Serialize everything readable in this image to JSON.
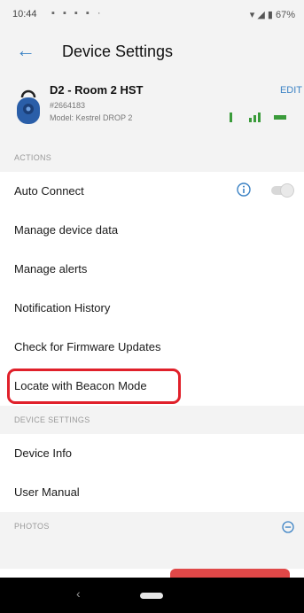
{
  "status_bar": {
    "time": "10:44",
    "right_text": "67%",
    "icons": [
      "notification-icon",
      "wifi-icon",
      "signal-icon",
      "battery-icon"
    ]
  },
  "header": {
    "title": "Device Settings",
    "back_icon": "arrow-left-icon"
  },
  "device": {
    "name": "D2 - Room 2 HST",
    "serial": "#2664183",
    "model": "Model: Kestrel DROP 2",
    "edit_label": "EDIT",
    "icon": "kestrel-drop-device-icon"
  },
  "sections": {
    "actions": "ACTIONS",
    "device_settings": "DEVICE SETTINGS",
    "photos": "PHOTOS"
  },
  "actions": [
    {
      "label": "Auto Connect"
    },
    {
      "label": "Manage device data"
    },
    {
      "label": "Manage alerts"
    },
    {
      "label": "Notification History"
    },
    {
      "label": "Check for Firmware Updates"
    },
    {
      "label": "Locate with Beacon Mode"
    }
  ],
  "device_settings": [
    {
      "label": "Device Info"
    },
    {
      "label": "User Manual"
    }
  ],
  "auto_connect_enabled": false,
  "colors": {
    "accent": "#3b82c4",
    "highlight": "#e0202a",
    "signal": "#3a9b3a",
    "danger": "#e04848"
  }
}
